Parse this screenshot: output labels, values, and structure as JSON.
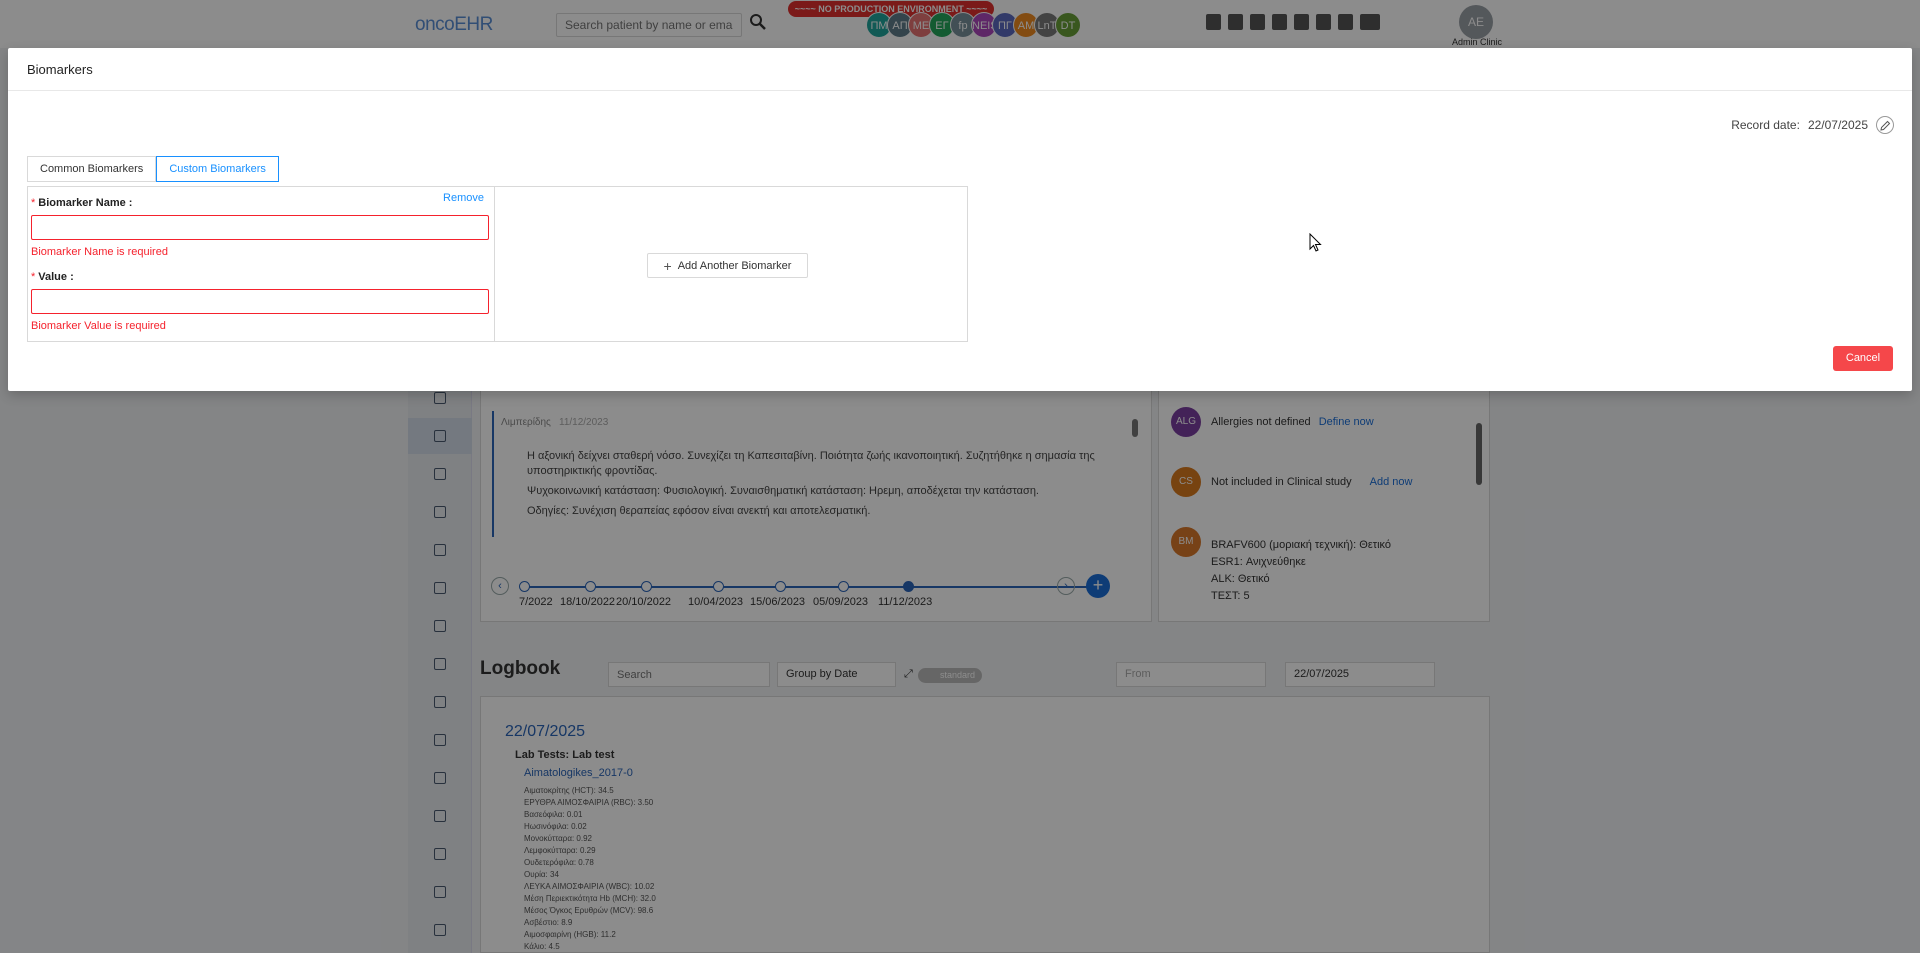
{
  "app": {
    "logo": "oncoEHR",
    "search_placeholder": "Search patient by name or email",
    "env_banner": "~~~~ NO PRODUCTION ENVIRONMENT ~~~~",
    "avatars": [
      {
        "initials": "ΠΜ",
        "color": "#1fa59b"
      },
      {
        "initials": "ΑΠ",
        "color": "#607d8b"
      },
      {
        "initials": "ΜΕ",
        "color": "#e57373"
      },
      {
        "initials": "ΕΓ",
        "color": "#26a65b"
      },
      {
        "initials": "fp",
        "color": "#78909c"
      },
      {
        "initials": "ΝΕΙS",
        "color": "#ab47bc"
      },
      {
        "initials": "ΠΓ",
        "color": "#5c6bc0"
      },
      {
        "initials": "ΑΜ",
        "color": "#ef8a22"
      },
      {
        "initials": "LnT",
        "color": "#7a7a7a"
      },
      {
        "initials": "DT",
        "color": "#689f38"
      }
    ],
    "user": {
      "initials": "ΑΕ",
      "name": "Admin Clinic"
    }
  },
  "notes": {
    "author": "Λιμπερίδης",
    "date": "11/12/2023",
    "paragraphs": [
      "Η αξονική δείχνει σταθερή νόσο. Συνεχίζει τη Καπεσιταβίνη. Ποιότητα ζωής ικανοποιητική. Συζητήθηκε η σημασία της υποστηρικτικής φροντίδας.",
      "Ψυχοκοινωνική κατάσταση: Φυσιολογική. Συναισθηματική κατάσταση: Ηρεμη, αποδέχεται την κατάσταση.",
      "Οδηγίες: Συνέχιση θεραπείας εφόσον είναι ανεκτή και αποτελεσματική."
    ],
    "timeline": [
      "7/2022",
      "18/10/2022",
      "20/10/2022",
      "10/04/2023",
      "15/06/2023",
      "05/09/2023",
      "11/12/2023"
    ]
  },
  "info": {
    "allergies": {
      "badge": "ALG",
      "text": "Allergies not defined",
      "link": "Define now",
      "color": "#7b3fa0"
    },
    "study": {
      "badge": "CS",
      "text": "Not included in Clinical study",
      "link": "Add now",
      "color": "#d97a1e"
    },
    "biomarkers": {
      "badge": "BM",
      "color": "#d9782a",
      "lines": [
        "BRAFV600 (μοριακή τεχνική): Θετικό",
        "ESR1: Ανιχνεύθηκε",
        "ALK: Θετικό",
        "ΤΕΣΤ: 5"
      ]
    }
  },
  "logbook": {
    "title": "Logbook",
    "search_placeholder": "Search",
    "group_by": "Group by Date",
    "toggle_label": "standard",
    "from_placeholder": "From",
    "to_date": "22/07/2025",
    "entry_date": "22/07/2025",
    "entry_type": "Lab Tests: Lab test",
    "file_name": "Aimatologikes_2017-0",
    "lines": [
      "Αιματοκρίτης (HCT): 34.5",
      "ΕΡΥΘΡΑ ΑΙΜΟΣΦΑΙΡΙΑ (RBC): 3.50",
      "Βασεόφιλα: 0.01",
      "Ηωσινόφιλα: 0.02",
      "Μονοκύτταρα: 0.92",
      "Λεμφοκύτταρα: 0.29",
      "Ουδετερόφιλα: 0.78",
      "Ουρία: 34",
      "ΛΕΥΚΑ ΑΙΜΟΣΦΑΙΡΙΑ (WBC): 10.02",
      "Μέση Περιεκτικότητα Hb (MCH): 32.0",
      "Μέσος Όγκος Ερυθρών (MCV): 98.6",
      "Ασβέστιο: 8.9",
      "Αιμοσφαιρίνη (HGB): 11.2",
      "Κάλιο: 4.5"
    ]
  },
  "modal": {
    "title": "Biomarkers",
    "record_date_label": "Record date:",
    "record_date": "22/07/2025",
    "tabs": [
      "Common Biomarkers",
      "Custom Biomarkers"
    ],
    "active_tab": "Custom Biomarkers",
    "remove_label": "Remove",
    "name_label": "Biomarker Name",
    "name_value": "",
    "name_error": "Biomarker Name is required",
    "value_label": "Value",
    "value_value": "",
    "value_error": "Biomarker Value is required",
    "add_another_label": "Add Another Biomarker",
    "cancel_label": "Cancel",
    "colors": {
      "primary": "#1890ff",
      "error": "#f5222d",
      "cancel": "#f5474a"
    }
  }
}
